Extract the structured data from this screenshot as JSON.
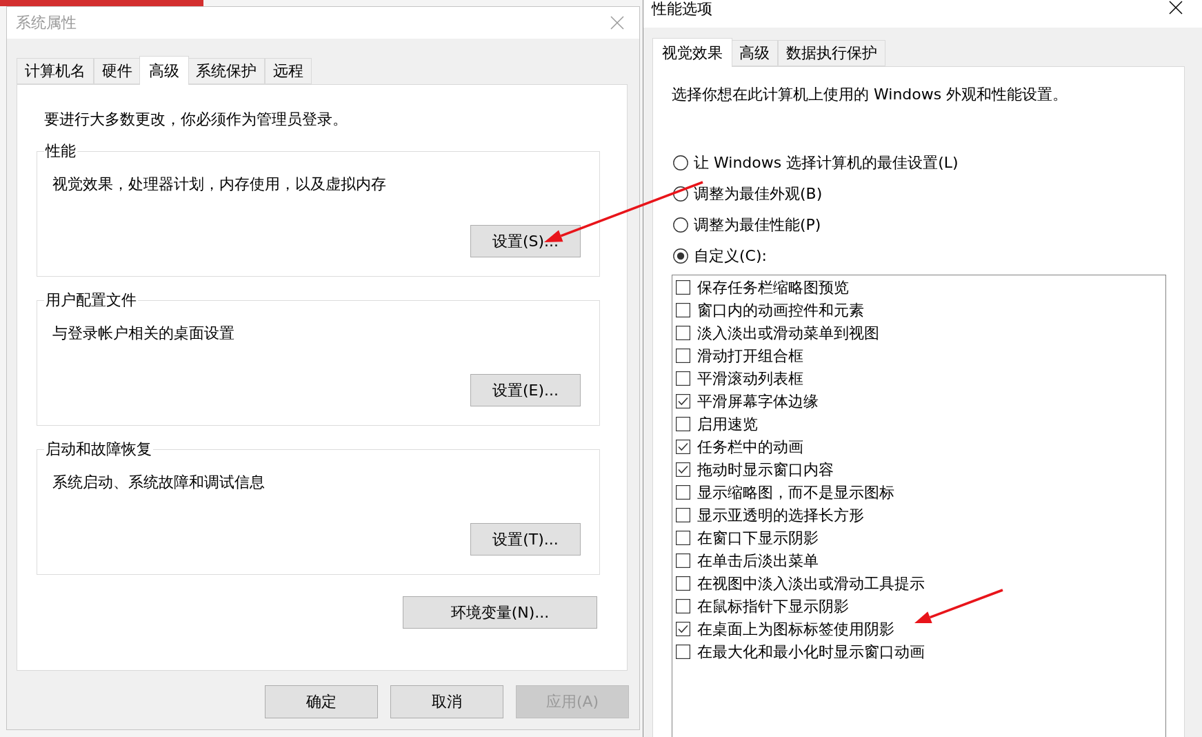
{
  "system_properties": {
    "title": "系统属性",
    "active": false,
    "tabs": [
      {
        "label": "计算机名",
        "selected": false
      },
      {
        "label": "硬件",
        "selected": false
      },
      {
        "label": "高级",
        "selected": true
      },
      {
        "label": "系统保护",
        "selected": false
      },
      {
        "label": "远程",
        "selected": false
      }
    ],
    "notice": "要进行大多数更改，你必须作为管理员登录。",
    "groups": [
      {
        "title": "性能",
        "description": "视觉效果，处理器计划，内存使用，以及虚拟内存",
        "button": "设置(S)..."
      },
      {
        "title": "用户配置文件",
        "description": "与登录帐户相关的桌面设置",
        "button": "设置(E)..."
      },
      {
        "title": "启动和故障恢复",
        "description": "系统启动、系统故障和调试信息",
        "button": "设置(T)..."
      }
    ],
    "environment_button": "环境变量(N)...",
    "buttons": [
      {
        "label": "确定",
        "disabled": false
      },
      {
        "label": "取消",
        "disabled": false
      },
      {
        "label": "应用(A)",
        "disabled": true
      }
    ]
  },
  "performance_options": {
    "title": "性能选项",
    "active": true,
    "tabs": [
      {
        "label": "视觉效果",
        "selected": true
      },
      {
        "label": "高级",
        "selected": false
      },
      {
        "label": "数据执行保护",
        "selected": false
      }
    ],
    "description": "选择你想在此计算机上使用的 Windows 外观和性能设置。",
    "options": [
      {
        "label": "让 Windows 选择计算机的最佳设置(L)",
        "selected": false
      },
      {
        "label": "调整为最佳外观(B)",
        "selected": false
      },
      {
        "label": "调整为最佳性能(P)",
        "selected": false
      },
      {
        "label": "自定义(C):",
        "selected": true
      }
    ],
    "effects": [
      {
        "label": "保存任务栏缩略图预览",
        "checked": false
      },
      {
        "label": "窗口内的动画控件和元素",
        "checked": false
      },
      {
        "label": "淡入淡出或滑动菜单到视图",
        "checked": false
      },
      {
        "label": "滑动打开组合框",
        "checked": false
      },
      {
        "label": "平滑滚动列表框",
        "checked": false
      },
      {
        "label": "平滑屏幕字体边缘",
        "checked": true
      },
      {
        "label": "启用速览",
        "checked": false
      },
      {
        "label": "任务栏中的动画",
        "checked": true
      },
      {
        "label": "拖动时显示窗口内容",
        "checked": true
      },
      {
        "label": "显示缩略图，而不是显示图标",
        "checked": false
      },
      {
        "label": "显示亚透明的选择长方形",
        "checked": false
      },
      {
        "label": "在窗口下显示阴影",
        "checked": false
      },
      {
        "label": "在单击后淡出菜单",
        "checked": false
      },
      {
        "label": "在视图中淡入淡出或滑动工具提示",
        "checked": false
      },
      {
        "label": "在鼠标指针下显示阴影",
        "checked": false
      },
      {
        "label": "在桌面上为图标标签使用阴影",
        "checked": true
      },
      {
        "label": "在最大化和最小化时显示窗口动画",
        "checked": false
      }
    ]
  }
}
